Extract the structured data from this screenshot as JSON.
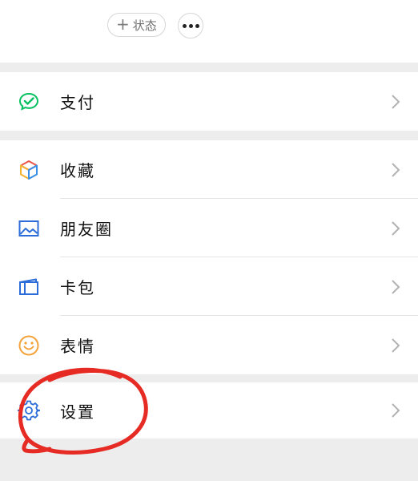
{
  "header": {
    "status_label": "状态",
    "status_icon": "plus-icon",
    "more_icon": "more-dots-icon"
  },
  "menu": {
    "pay": {
      "label": "支付",
      "icon": "wechat-pay-icon"
    },
    "favorites": {
      "label": "收藏",
      "icon": "cube-icon"
    },
    "moments": {
      "label": "朋友圈",
      "icon": "photo-icon"
    },
    "cards": {
      "label": "卡包",
      "icon": "card-icon"
    },
    "stickers": {
      "label": "表情",
      "icon": "smiley-icon"
    },
    "settings": {
      "label": "设置",
      "icon": "gear-icon"
    }
  },
  "colors": {
    "pay_green": "#07c160",
    "accent_blue": "#2b6cd8",
    "smiley_orange": "#f3a33a",
    "annotation_red": "#e52b23",
    "background": "#ededed"
  }
}
